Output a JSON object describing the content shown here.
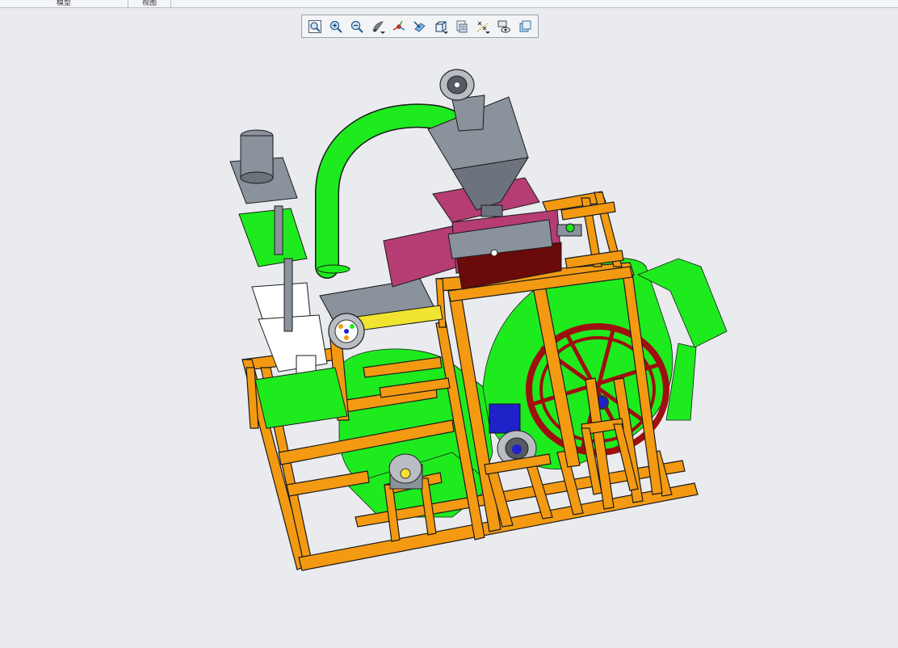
{
  "header": {
    "tabs": [
      {
        "label": "模型"
      },
      {
        "label": "视图"
      }
    ]
  },
  "view_toolbar": {
    "buttons": [
      {
        "name": "refit-button",
        "icon": "zoom-fit-icon"
      },
      {
        "name": "zoom-in-button",
        "icon": "zoom-in-icon"
      },
      {
        "name": "zoom-out-button",
        "icon": "zoom-out-icon"
      },
      {
        "name": "repaint-button",
        "icon": "repaint-icon"
      },
      {
        "name": "spin-center-button",
        "icon": "spin-center-icon"
      },
      {
        "name": "view-normal-button",
        "icon": "view-normal-icon"
      },
      {
        "name": "saved-orientations-button",
        "icon": "saved-views-icon"
      },
      {
        "name": "display-style-button",
        "icon": "display-style-icon"
      },
      {
        "name": "datum-display-button",
        "icon": "datum-display-icon"
      },
      {
        "name": "view-manager-button",
        "icon": "view-manager-icon"
      },
      {
        "name": "appearance-button",
        "icon": "appearance-icon"
      }
    ]
  },
  "colors": {
    "frame": "#f39a12",
    "frame_edge": "#1a1a1a",
    "fan_housing": "#1eeb1e",
    "hopper": "#8a929c",
    "tray": "#b53d73",
    "tray_dark": "#6b0a0a",
    "wheel": "#a00f0f",
    "motor": "#1e22c8",
    "viewport_bg": "#e9ebef"
  }
}
